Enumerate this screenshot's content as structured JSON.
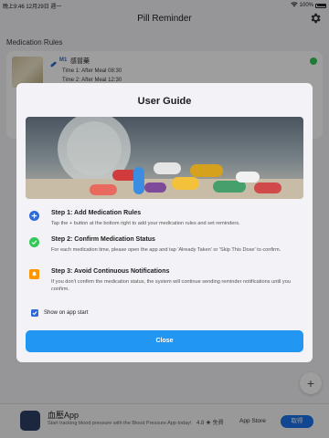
{
  "status_bar": {
    "time": "晚上9:46  12月29日 週一",
    "battery": "100%",
    "battery_level": 1.0
  },
  "header": {
    "title": "Pill Reminder"
  },
  "rules_section": {
    "title": "Medication Rules"
  },
  "rule_card": {
    "tag": "M1",
    "name": "感冒藥",
    "time1": "Time 1: After Meal 08:30",
    "time2": "Time 2: After Meal 12:30"
  },
  "guide": {
    "title": "User Guide",
    "steps": [
      {
        "title": "Step 1: Add Medication Rules",
        "desc": "Tap the + button at the bottom right to add your medication rules and set reminders.",
        "icon": "plus-circle-icon",
        "color": "#2f6bd6"
      },
      {
        "title": "Step 2: Confirm Medication Status",
        "desc": "For each medication time, please open the app and tap 'Already Taken' or 'Skip This Dose' to confirm.",
        "icon": "check-circle-icon",
        "color": "#34c759"
      },
      {
        "title": "Step 3: Avoid Continuous Notifications",
        "desc": "If you don't confirm the medication status, the system will continue sending reminder notifications until you confirm.",
        "icon": "bell-icon",
        "color": "#ff9500"
      }
    ],
    "show_on_start": "Show on app start",
    "close": "Close"
  },
  "ad": {
    "name": "血壓App",
    "desc": "Start tracking blood pressure with the Blood Pressure App today!",
    "rating": "4.8 ★  免費",
    "store": "App Store",
    "button": "取得"
  },
  "colors": {
    "accent": "#2196f3",
    "checkbox": "#2f6bd6"
  }
}
